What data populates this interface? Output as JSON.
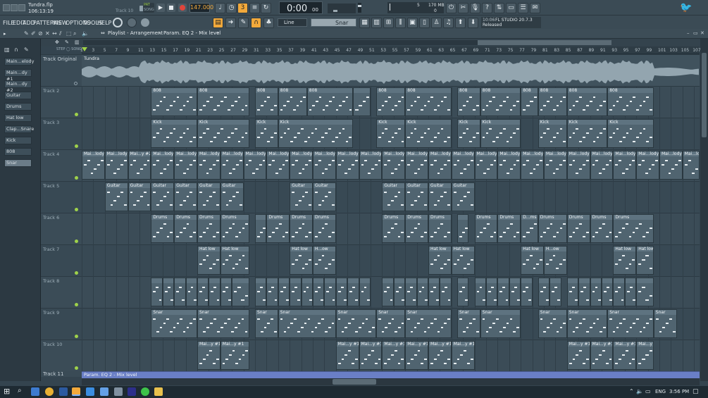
{
  "window": {
    "file_name": "Tundra.flp",
    "time_position": "106:13:19",
    "track_hint": "Track 10"
  },
  "menus": [
    "FILE",
    "EDIT",
    "ADD",
    "PATTERNS",
    "VIEW",
    "OPTIONS",
    "TOOLS",
    "HELP"
  ],
  "transport": {
    "bpm": "147.000",
    "time": "0:00",
    "time_small": "00",
    "pat_label": "PAT",
    "song_label": "SONG",
    "cpu": "5",
    "ram": "170 MB",
    "voices": "0"
  },
  "toolbar": {
    "pattern_name": "Snar",
    "snap_mode": "Line",
    "hint_time": "10:06",
    "hint_title": "FL STUDIO 20.7.3",
    "hint_status": "Released"
  },
  "playlist": {
    "breadcrumb": "Playlist - Arrangement",
    "target": "Param. EQ 2 - Mix level",
    "pattern_lane_label": "Tundra",
    "lane11_label": "Param. EQ 2 - Mix level"
  },
  "channels": [
    "Main...elody",
    "Main...dy #1",
    "Main...dy #2",
    "Guitar",
    "Drums",
    "Hat low",
    "Clap...Snare",
    "Kick",
    "808",
    "Snar"
  ],
  "ruler": [
    "1",
    "3",
    "5",
    "7",
    "9",
    "11",
    "13",
    "15",
    "17",
    "19",
    "21",
    "23",
    "25",
    "27",
    "29",
    "31",
    "33",
    "35",
    "37",
    "39",
    "41",
    "43",
    "45",
    "47",
    "49",
    "51",
    "53",
    "55",
    "57",
    "59",
    "61",
    "63",
    "65",
    "67",
    "69",
    "71",
    "73",
    "75",
    "77",
    "79",
    "81",
    "83",
    "85",
    "87",
    "89",
    "91",
    "93",
    "95",
    "97",
    "99",
    "101",
    "103",
    "105",
    "107"
  ],
  "track_names": [
    "Track Original",
    "Track 2",
    "Track 3",
    "Track 4",
    "Track 5",
    "Track 6",
    "Track 7",
    "Track 8",
    "Track 9",
    "Track 10",
    "Track 11"
  ],
  "tracks": [
    {
      "row": 1,
      "name": "808",
      "clips": [
        {
          "s": 13,
          "e": 21,
          "l": "808"
        },
        {
          "s": 21,
          "e": 30,
          "l": "808"
        },
        {
          "s": 31,
          "e": 35,
          "l": "808"
        },
        {
          "s": 35,
          "e": 40,
          "l": "808"
        },
        {
          "s": 40,
          "e": 48,
          "l": "808"
        },
        {
          "s": 48,
          "e": 51,
          "l": ""
        },
        {
          "s": 52,
          "e": 57,
          "l": "808"
        },
        {
          "s": 57,
          "e": 65,
          "l": "808"
        },
        {
          "s": 66,
          "e": 70,
          "l": "808"
        },
        {
          "s": 70,
          "e": 77,
          "l": "808"
        },
        {
          "s": 77,
          "e": 80,
          "l": "808"
        },
        {
          "s": 80,
          "e": 85,
          "l": "808"
        },
        {
          "s": 85,
          "e": 92,
          "l": "808"
        },
        {
          "s": 92,
          "e": 100,
          "l": "808"
        }
      ]
    },
    {
      "row": 2,
      "name": "Kick",
      "clips": [
        {
          "s": 13,
          "e": 21,
          "l": "Kick"
        },
        {
          "s": 21,
          "e": 30,
          "l": "Kick"
        },
        {
          "s": 31,
          "e": 35,
          "l": "Kick"
        },
        {
          "s": 35,
          "e": 48,
          "l": "Kick"
        },
        {
          "s": 52,
          "e": 57,
          "l": "Kick"
        },
        {
          "s": 57,
          "e": 65,
          "l": "Kick"
        },
        {
          "s": 66,
          "e": 70,
          "l": "Kick"
        },
        {
          "s": 70,
          "e": 77,
          "l": "Kick"
        },
        {
          "s": 80,
          "e": 85,
          "l": "Kick"
        },
        {
          "s": 85,
          "e": 92,
          "l": "Kick"
        },
        {
          "s": 92,
          "e": 100,
          "l": "Kick"
        }
      ]
    },
    {
      "row": 3,
      "name": "Main...lody",
      "clips": [
        {
          "s": 1,
          "e": 5,
          "l": "Mai...lody"
        },
        {
          "s": 5,
          "e": 9,
          "l": "Mai...lody"
        },
        {
          "s": 9,
          "e": 13,
          "l": "Mai...y #2"
        },
        {
          "s": 13,
          "e": 17,
          "l": "Mai...lody"
        },
        {
          "s": 17,
          "e": 21,
          "l": "Mai...lody"
        },
        {
          "s": 21,
          "e": 25,
          "l": "Mai...lody"
        },
        {
          "s": 25,
          "e": 29,
          "l": "Mai...lody"
        },
        {
          "s": 29,
          "e": 33,
          "l": "Mai...lody"
        },
        {
          "s": 33,
          "e": 37,
          "l": "Mai...lody"
        },
        {
          "s": 37,
          "e": 41,
          "l": "Mai...lody"
        },
        {
          "s": 41,
          "e": 45,
          "l": "Mai...lody"
        },
        {
          "s": 45,
          "e": 49,
          "l": "Mai...lody"
        },
        {
          "s": 49,
          "e": 53,
          "l": "Mai...lody"
        },
        {
          "s": 53,
          "e": 57,
          "l": "Mai...lody"
        },
        {
          "s": 57,
          "e": 61,
          "l": "Mai...lody"
        },
        {
          "s": 61,
          "e": 65,
          "l": "Mai...lody"
        },
        {
          "s": 65,
          "e": 69,
          "l": "Mai...lody"
        },
        {
          "s": 69,
          "e": 73,
          "l": "Mai...lody"
        },
        {
          "s": 73,
          "e": 77,
          "l": "Mai...lody"
        },
        {
          "s": 77,
          "e": 81,
          "l": "Mai...lody"
        },
        {
          "s": 81,
          "e": 85,
          "l": "Mai...lody"
        },
        {
          "s": 85,
          "e": 89,
          "l": "Mai...lody"
        },
        {
          "s": 89,
          "e": 93,
          "l": "Mai...lody"
        },
        {
          "s": 93,
          "e": 97,
          "l": "Mai...lody"
        },
        {
          "s": 97,
          "e": 101,
          "l": "Mai...lody"
        },
        {
          "s": 101,
          "e": 105,
          "l": "Mai...lody"
        },
        {
          "s": 105,
          "e": 109,
          "l": "Mai...lody"
        }
      ]
    },
    {
      "row": 4,
      "name": "Guitar",
      "clips": [
        {
          "s": 5,
          "e": 9,
          "l": "Guitar"
        },
        {
          "s": 9,
          "e": 13,
          "l": "Guitar"
        },
        {
          "s": 13,
          "e": 17,
          "l": "Guitar"
        },
        {
          "s": 17,
          "e": 21,
          "l": "Guitar"
        },
        {
          "s": 21,
          "e": 25,
          "l": "Guitar"
        },
        {
          "s": 25,
          "e": 29,
          "l": "Guitar"
        },
        {
          "s": 37,
          "e": 41,
          "l": "Guitar"
        },
        {
          "s": 41,
          "e": 45,
          "l": "Guitar"
        },
        {
          "s": 53,
          "e": 57,
          "l": "Guitar"
        },
        {
          "s": 57,
          "e": 61,
          "l": "Guitar"
        },
        {
          "s": 61,
          "e": 65,
          "l": "Guitar"
        },
        {
          "s": 65,
          "e": 69,
          "l": "Guitar"
        }
      ]
    },
    {
      "row": 5,
      "name": "Drums",
      "clips": [
        {
          "s": 13,
          "e": 17,
          "l": "Drums"
        },
        {
          "s": 17,
          "e": 21,
          "l": "Drums"
        },
        {
          "s": 21,
          "e": 25,
          "l": "Drums"
        },
        {
          "s": 25,
          "e": 30,
          "l": "Drums"
        },
        {
          "s": 31,
          "e": 33,
          "l": ""
        },
        {
          "s": 33,
          "e": 37,
          "l": "Drums"
        },
        {
          "s": 37,
          "e": 41,
          "l": "Drums"
        },
        {
          "s": 41,
          "e": 45,
          "l": "Drums"
        },
        {
          "s": 53,
          "e": 57,
          "l": "Drums"
        },
        {
          "s": 57,
          "e": 61,
          "l": "Drums"
        },
        {
          "s": 61,
          "e": 65,
          "l": "Drums"
        },
        {
          "s": 66,
          "e": 68,
          "l": ""
        },
        {
          "s": 69,
          "e": 73,
          "l": "Drums"
        },
        {
          "s": 73,
          "e": 77,
          "l": "Drums"
        },
        {
          "s": 77,
          "e": 80,
          "l": "D...ms"
        },
        {
          "s": 80,
          "e": 85,
          "l": "Drums"
        },
        {
          "s": 85,
          "e": 89,
          "l": "Drums"
        },
        {
          "s": 89,
          "e": 93,
          "l": "Drums"
        },
        {
          "s": 93,
          "e": 100,
          "l": "Drums"
        }
      ]
    },
    {
      "row": 6,
      "name": "Hat low",
      "clips": [
        {
          "s": 21,
          "e": 25,
          "l": "Hat low"
        },
        {
          "s": 25,
          "e": 30,
          "l": "Hat low"
        },
        {
          "s": 37,
          "e": 41,
          "l": "Hat low"
        },
        {
          "s": 41,
          "e": 45,
          "l": "H...ow"
        },
        {
          "s": 61,
          "e": 65,
          "l": "Hat low"
        },
        {
          "s": 65,
          "e": 69,
          "l": "Hat low"
        },
        {
          "s": 77,
          "e": 81,
          "l": "Hat low"
        },
        {
          "s": 81,
          "e": 85,
          "l": "H...ow"
        },
        {
          "s": 93,
          "e": 97,
          "l": "Hat low"
        },
        {
          "s": 97,
          "e": 100,
          "l": "Hat low"
        }
      ]
    },
    {
      "row": 7,
      "name": "Clap",
      "clips": [
        {
          "s": 13,
          "e": 15,
          "l": ""
        },
        {
          "s": 15,
          "e": 17,
          "l": ""
        },
        {
          "s": 17,
          "e": 19,
          "l": ""
        },
        {
          "s": 19,
          "e": 21,
          "l": ""
        },
        {
          "s": 21,
          "e": 23,
          "l": ""
        },
        {
          "s": 23,
          "e": 25,
          "l": ""
        },
        {
          "s": 25,
          "e": 27,
          "l": ""
        },
        {
          "s": 27,
          "e": 30,
          "l": ""
        },
        {
          "s": 31,
          "e": 33,
          "l": ""
        },
        {
          "s": 33,
          "e": 35,
          "l": ""
        },
        {
          "s": 35,
          "e": 37,
          "l": ""
        },
        {
          "s": 37,
          "e": 39,
          "l": ""
        },
        {
          "s": 39,
          "e": 41,
          "l": ""
        },
        {
          "s": 41,
          "e": 43,
          "l": ""
        },
        {
          "s": 43,
          "e": 45,
          "l": ""
        },
        {
          "s": 45,
          "e": 47,
          "l": ""
        },
        {
          "s": 47,
          "e": 49,
          "l": ""
        },
        {
          "s": 49,
          "e": 51,
          "l": ""
        },
        {
          "s": 53,
          "e": 55,
          "l": ""
        },
        {
          "s": 55,
          "e": 57,
          "l": ""
        },
        {
          "s": 57,
          "e": 59,
          "l": ""
        },
        {
          "s": 59,
          "e": 61,
          "l": ""
        },
        {
          "s": 61,
          "e": 63,
          "l": ""
        },
        {
          "s": 63,
          "e": 65,
          "l": ""
        },
        {
          "s": 66,
          "e": 68,
          "l": ""
        },
        {
          "s": 69,
          "e": 71,
          "l": ""
        },
        {
          "s": 71,
          "e": 73,
          "l": ""
        },
        {
          "s": 73,
          "e": 75,
          "l": ""
        },
        {
          "s": 75,
          "e": 77,
          "l": ""
        },
        {
          "s": 77,
          "e": 79,
          "l": ""
        },
        {
          "s": 80,
          "e": 82,
          "l": ""
        },
        {
          "s": 82,
          "e": 84,
          "l": ""
        },
        {
          "s": 85,
          "e": 87,
          "l": ""
        },
        {
          "s": 87,
          "e": 89,
          "l": ""
        },
        {
          "s": 89,
          "e": 91,
          "l": ""
        },
        {
          "s": 91,
          "e": 93,
          "l": ""
        },
        {
          "s": 93,
          "e": 95,
          "l": ""
        },
        {
          "s": 95,
          "e": 97,
          "l": ""
        },
        {
          "s": 97,
          "e": 100,
          "l": ""
        }
      ]
    },
    {
      "row": 8,
      "name": "Snar",
      "clips": [
        {
          "s": 13,
          "e": 21,
          "l": "Snar"
        },
        {
          "s": 21,
          "e": 30,
          "l": "Snar"
        },
        {
          "s": 31,
          "e": 35,
          "l": "Snar"
        },
        {
          "s": 35,
          "e": 45,
          "l": "Snar"
        },
        {
          "s": 45,
          "e": 52,
          "l": "Snar"
        },
        {
          "s": 52,
          "e": 57,
          "l": "Snar"
        },
        {
          "s": 57,
          "e": 65,
          "l": "Snar"
        },
        {
          "s": 66,
          "e": 70,
          "l": "Snar"
        },
        {
          "s": 70,
          "e": 77,
          "l": "Snar"
        },
        {
          "s": 80,
          "e": 85,
          "l": "Snar"
        },
        {
          "s": 85,
          "e": 92,
          "l": "Snar"
        },
        {
          "s": 92,
          "e": 100,
          "l": "Snar"
        },
        {
          "s": 100,
          "e": 104,
          "l": "Snar"
        }
      ]
    },
    {
      "row": 9,
      "name": "Main...y #1",
      "clips": [
        {
          "s": 21,
          "e": 25,
          "l": "Mai...y #1"
        },
        {
          "s": 25,
          "e": 30,
          "l": "Mai...y #1"
        },
        {
          "s": 45,
          "e": 49,
          "l": "Mai...y #1"
        },
        {
          "s": 49,
          "e": 53,
          "l": "Mai...y #1"
        },
        {
          "s": 53,
          "e": 57,
          "l": "Mai...y #1"
        },
        {
          "s": 57,
          "e": 61,
          "l": "Mai...y #1"
        },
        {
          "s": 61,
          "e": 65,
          "l": "Mai...y #1"
        },
        {
          "s": 65,
          "e": 69,
          "l": "Mai...y #1"
        },
        {
          "s": 85,
          "e": 89,
          "l": "Mai...y #1"
        },
        {
          "s": 89,
          "e": 93,
          "l": "Mai...y #1"
        },
        {
          "s": 93,
          "e": 97,
          "l": "Mai...y #1"
        },
        {
          "s": 97,
          "e": 100,
          "l": "Mai...y #1"
        }
      ]
    }
  ],
  "taskbar": {
    "lang": "ENG",
    "clock": "3:56 PM"
  },
  "colors": {
    "accent": "#f2a93b",
    "record": "#e0453b",
    "play": "#9fd24a"
  }
}
